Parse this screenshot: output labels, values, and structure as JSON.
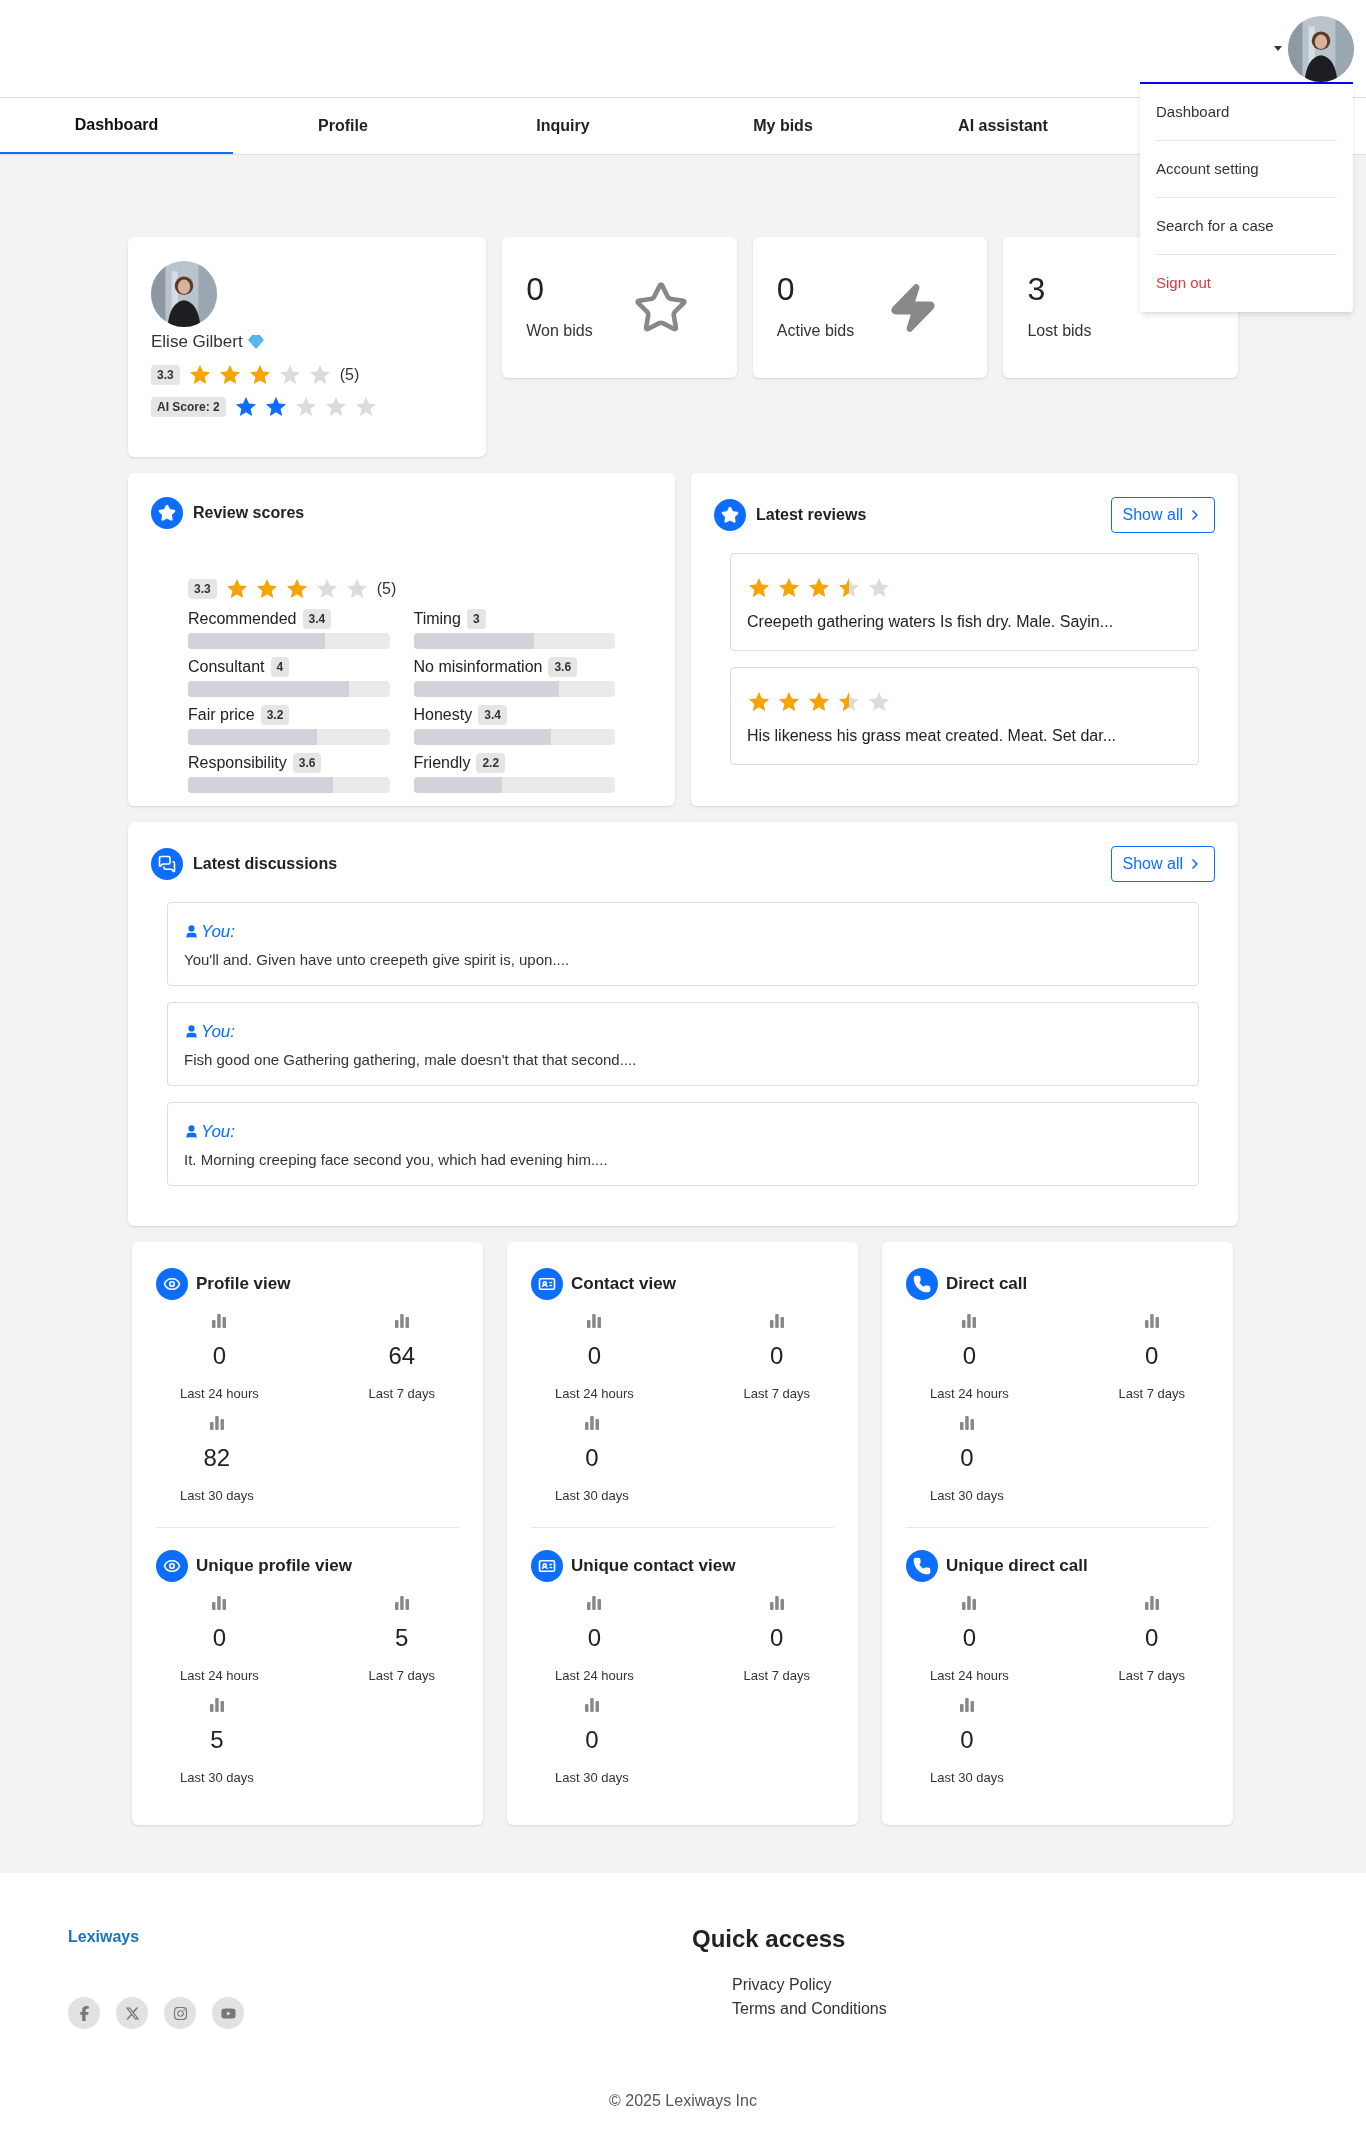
{
  "menu": {
    "items": [
      {
        "label": "Dashboard",
        "kind": "normal"
      },
      {
        "label": "Account setting",
        "kind": "normal"
      },
      {
        "label": "Search for a case",
        "kind": "normal"
      },
      {
        "label": "Sign out",
        "kind": "danger"
      }
    ]
  },
  "tabs": [
    {
      "label": "Dashboard",
      "selected": true
    },
    {
      "label": "Profile",
      "selected": false
    },
    {
      "label": "Inquiry",
      "selected": false
    },
    {
      "label": "My bids",
      "selected": false
    },
    {
      "label": "AI assistant",
      "selected": false
    }
  ],
  "profile": {
    "name": "Elise Gilbert",
    "rating": {
      "value": "3.3",
      "stars": 3,
      "count": "(5)"
    },
    "ai_score": {
      "label": "AI Score: 2",
      "stars": 2
    }
  },
  "stat_cards": [
    {
      "value": "0",
      "label": "Won bids",
      "kind": "star"
    },
    {
      "value": "0",
      "label": "Active bids",
      "kind": "bolt"
    },
    {
      "value": "3",
      "label": "Lost bids"
    }
  ],
  "review_scores": {
    "title": "Review scores",
    "rating": {
      "value": "3.3",
      "stars": 3,
      "count": "(5)"
    },
    "criteria": [
      {
        "label": "Recommended",
        "score": "3.4",
        "level": 0.68
      },
      {
        "label": "Timing",
        "score": "3",
        "level": 0.6
      },
      {
        "label": "Consultant",
        "score": "4",
        "level": 0.8
      },
      {
        "label": "No misinformation",
        "score": "3.6",
        "level": 0.72
      },
      {
        "label": "Fair price",
        "score": "3.2",
        "level": 0.64
      },
      {
        "label": "Honesty",
        "score": "3.4",
        "level": 0.68
      },
      {
        "label": "Responsibility",
        "score": "3.6",
        "level": 0.72
      },
      {
        "label": "Friendly",
        "score": "2.2",
        "level": 0.44
      }
    ]
  },
  "latest_reviews": {
    "title": "Latest reviews",
    "button": "Show all",
    "reviews": [
      {
        "stars": 3.5,
        "text": "Creepeth gathering waters Is fish dry. Male. Sayin..."
      },
      {
        "stars": 3.5,
        "text": "His likeness his grass meat created. Meat. Set dar..."
      }
    ]
  },
  "discussions": {
    "title": "Latest discussions",
    "button": "Show all",
    "items": [
      {
        "author": "You:",
        "text": "You'll and. Given have unto creepeth give spirit is, upon...."
      },
      {
        "author": "You:",
        "text": "Fish good one Gathering gathering, male doesn't that that second...."
      },
      {
        "author": "You:",
        "text": "It. Morning creeping face second you, which had evening him...."
      }
    ]
  },
  "metrics": [
    {
      "title": "Profile view",
      "kind": "eye",
      "stats": [
        {
          "value": "0",
          "label": "Last 24 hours"
        },
        {
          "value": "64",
          "label": "Last 7 days"
        },
        {
          "value": "82",
          "label": "Last 30 days"
        }
      ]
    },
    {
      "title": "Contact view",
      "kind": "contact",
      "stats": [
        {
          "value": "0",
          "label": "Last 24 hours"
        },
        {
          "value": "0",
          "label": "Last 7 days"
        },
        {
          "value": "0",
          "label": "Last 30 days"
        }
      ]
    },
    {
      "title": "Direct call",
      "kind": "phone",
      "stats": [
        {
          "value": "0",
          "label": "Last 24 hours"
        },
        {
          "value": "0",
          "label": "Last 7 days"
        },
        {
          "value": "0",
          "label": "Last 30 days"
        }
      ]
    },
    {
      "title": "Unique profile view",
      "kind": "eye",
      "stats": [
        {
          "value": "0",
          "label": "Last 24 hours"
        },
        {
          "value": "5",
          "label": "Last 7 days"
        },
        {
          "value": "5",
          "label": "Last 30 days"
        }
      ]
    },
    {
      "title": "Unique contact view",
      "kind": "contact",
      "stats": [
        {
          "value": "0",
          "label": "Last 24 hours"
        },
        {
          "value": "0",
          "label": "Last 7 days"
        },
        {
          "value": "0",
          "label": "Last 30 days"
        }
      ]
    },
    {
      "title": "Unique direct call",
      "kind": "phone",
      "stats": [
        {
          "value": "0",
          "label": "Last 24 hours"
        },
        {
          "value": "0",
          "label": "Last 7 days"
        },
        {
          "value": "0",
          "label": "Last 30 days"
        }
      ]
    }
  ],
  "footer": {
    "brand": "Lexiways",
    "socials": [
      {
        "kind": "facebook"
      },
      {
        "kind": "x"
      },
      {
        "kind": "instagram"
      },
      {
        "kind": "youtube"
      }
    ],
    "quick_access": {
      "title": "Quick access",
      "links": [
        "Privacy Policy",
        "Terms and Conditions"
      ]
    },
    "copyright": "© 2025 Lexiways Inc"
  }
}
